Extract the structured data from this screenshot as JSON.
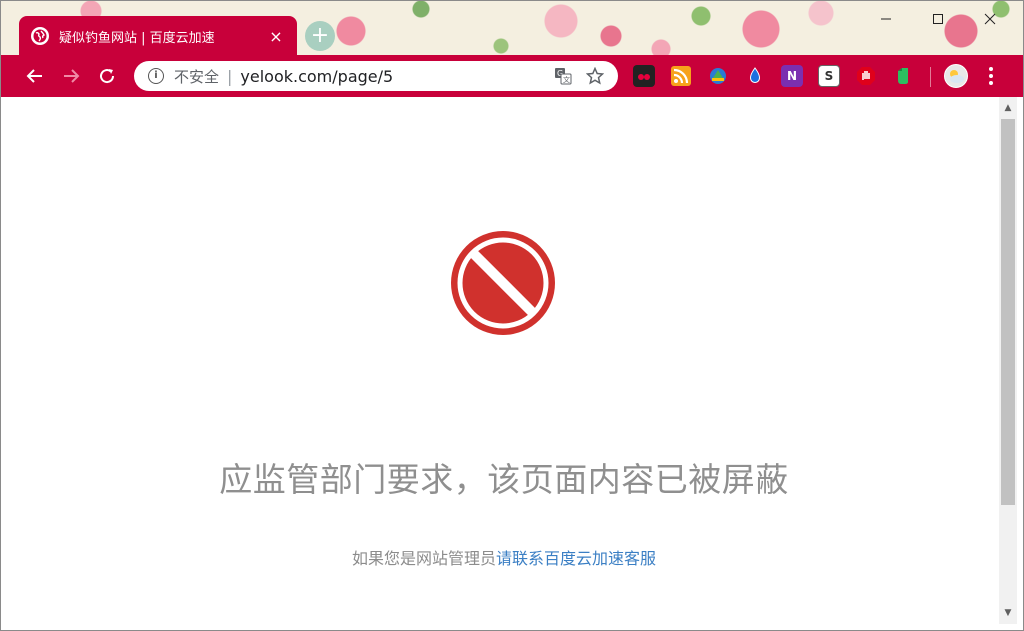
{
  "tab": {
    "title": "疑似钓鱼网站 | 百度云加速",
    "close_label": "×"
  },
  "new_tab_label": "+",
  "window_controls": {
    "minimize": "—",
    "close": "✕"
  },
  "address_bar": {
    "security_label": "不安全",
    "separator": "|",
    "url": "yelook.com/page/5"
  },
  "extensions": [
    "ext-a",
    "ext-rss",
    "ext-c",
    "ext-drop",
    "ext-onenote",
    "ext-s",
    "ext-hand",
    "ext-evernote"
  ],
  "extension_labels": {
    "onenote": "N",
    "s": "S"
  },
  "colors": {
    "accent": "#c8003a",
    "block_red": "#d0312d",
    "link": "#3b7fc4"
  },
  "page": {
    "headline": "应监管部门要求，该页面内容已被屏蔽",
    "admin_prefix": "如果您是网站管理员",
    "contact_link": "请联系百度云加速客服"
  }
}
